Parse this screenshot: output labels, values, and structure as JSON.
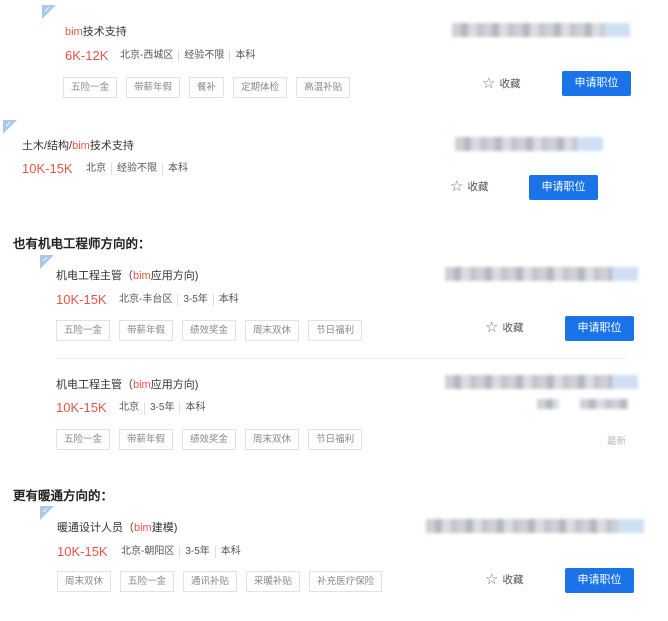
{
  "jobs": [
    {
      "title_pre": "",
      "title_hl": "bim",
      "title_post": "技术支持",
      "salary": "6K-12K",
      "meta": [
        "北京-西城区",
        "经验不限",
        "本科"
      ],
      "tags": [
        "五险一金",
        "带薪年假",
        "餐补",
        "定期体检",
        "高温补贴"
      ],
      "fav_label": "收藏",
      "apply_label": "申请职位"
    },
    {
      "title_pre": "土木/结构/",
      "title_hl": "bim",
      "title_post": "技术支持",
      "salary": "10K-15K",
      "meta": [
        "北京",
        "经验不限",
        "本科"
      ],
      "tags": [],
      "fav_label": "收藏",
      "apply_label": "申请职位"
    },
    {
      "title_pre": "机电工程主管（",
      "title_hl": "bim",
      "title_post": "应用方向)",
      "salary": "10K-15K",
      "meta": [
        "北京-丰台区",
        "3-5年",
        "本科"
      ],
      "tags": [
        "五险一金",
        "带薪年假",
        "绩效奖金",
        "周末双休",
        "节日福利"
      ],
      "fav_label": "收藏",
      "apply_label": "申请职位"
    },
    {
      "title_pre": "机电工程主管（",
      "title_hl": "bim",
      "title_post": "应用方向)",
      "salary": "10K-15K",
      "meta": [
        "北京",
        "3-5年",
        "本科"
      ],
      "tags": [
        "五险一金",
        "带薪年假",
        "绩效奖金",
        "周末双休",
        "节日福利"
      ],
      "latest_label": "最新"
    },
    {
      "title_pre": "暖通设计人员（",
      "title_hl": "bim",
      "title_post": "建模)",
      "salary": "10K-15K",
      "meta": [
        "北京-朝阳区",
        "3-5年",
        "本科"
      ],
      "tags": [
        "周末双休",
        "五险一金",
        "通讯补贴",
        "采暖补贴",
        "补充医疗保险"
      ],
      "fav_label": "收藏",
      "apply_label": "申请职位"
    }
  ],
  "sections": {
    "mep": "也有机电工程师方向的：",
    "hvac": "更有暖通方向的："
  },
  "colors": {
    "accent": "#1a73e8",
    "salary": "#e8544a",
    "corner": "#a8c8ec"
  },
  "icons": {
    "favorite": "star-outline-icon",
    "corner": "check-corner-icon"
  }
}
